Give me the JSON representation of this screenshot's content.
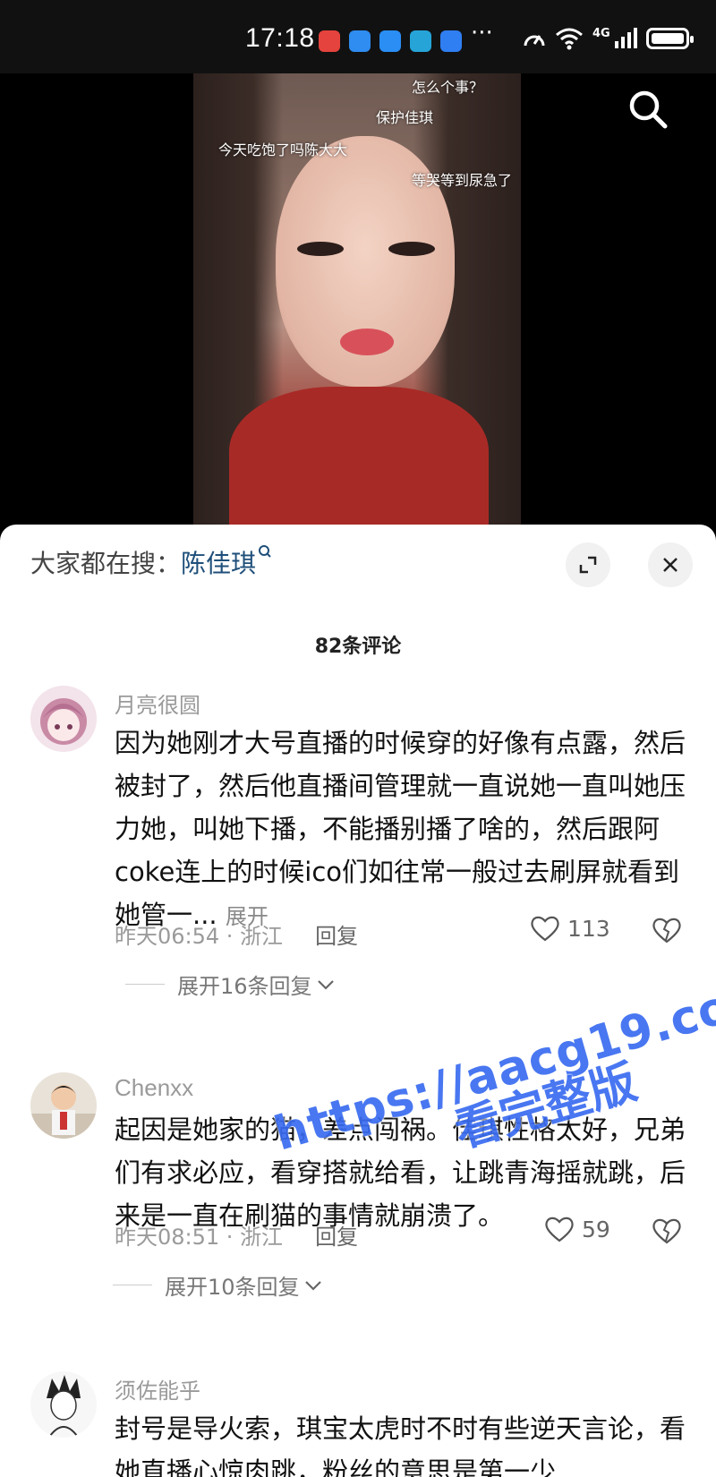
{
  "status_bar": {
    "time": "17:18",
    "more": "···",
    "network": "4G",
    "app_colors": [
      "#e5433d",
      "#2f8cf0",
      "#2a8ef5",
      "#26a4d8",
      "#2f7ef2"
    ]
  },
  "video": {
    "danmaku": [
      "怎么个事？",
      "保护佳琪",
      "今天吃饱了吗陈大大",
      "等哭等到尿急了"
    ]
  },
  "sheet": {
    "search_prefix": "大家都在搜：",
    "search_term": "陈佳琪",
    "comment_count": "82条评论"
  },
  "comments": [
    {
      "username": "月亮很圆",
      "text": "因为她刚才大号直播的时候穿的好像有点露，然后被封了，然后他直播间管理就一直说她一直叫她压力她，叫她下播，不能播别播了啥的，然后跟阿coke连上的时候ico们如往常一般过去刷屏就看到她管一...",
      "expand": "展开",
      "time": "昨天06:54",
      "location": "浙江",
      "reply_label": "回复",
      "likes": "113",
      "replies": "展开16条回复"
    },
    {
      "username": "Chenxx",
      "text": "起因是她家的猫，差点闯祸。佳琪性格太好，兄弟们有求必应，看穿搭就给看，让跳青海摇就跳，后来是一直在刷猫的事情就崩溃了。",
      "time": "昨天08:51",
      "location": "浙江",
      "reply_label": "回复",
      "likes": "59",
      "replies": "展开10条回复"
    },
    {
      "username": "须佐能乎",
      "text": "封号是导火索，琪宝太虎时不时有些逆天言论，看她直播心惊肉跳，粉丝的意思是第一少"
    }
  ],
  "watermark": {
    "url": "https://aacg19.com",
    "caption": "看完整版"
  }
}
